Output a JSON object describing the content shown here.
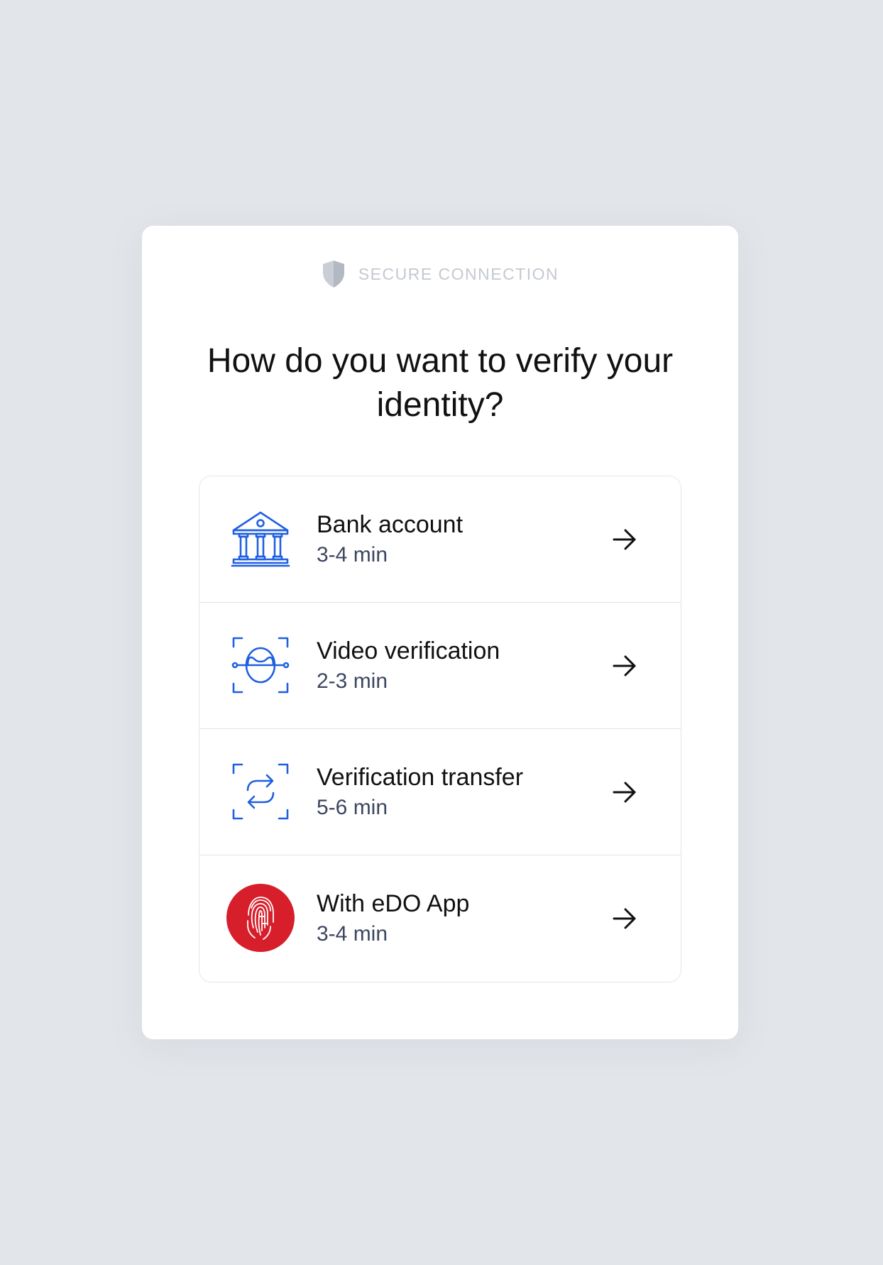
{
  "header": {
    "secure_label": "SECURE CONNECTION",
    "secure_icon": "shield-icon"
  },
  "title": "How do you want to verify your identity?",
  "options": [
    {
      "label": "Bank account",
      "time": "3-4 min",
      "icon": "bank-icon"
    },
    {
      "label": "Video verification",
      "time": "2-3 min",
      "icon": "face-scan-icon"
    },
    {
      "label": "Verification transfer",
      "time": "5-6 min",
      "icon": "transfer-icon"
    },
    {
      "label": "With eDO App",
      "time": "3-4 min",
      "icon": "fingerprint-icon"
    }
  ],
  "colors": {
    "accent_blue": "#1f5fe0",
    "edo_red": "#d71f2b",
    "background": "#e2e5e9",
    "card": "#ffffff"
  }
}
